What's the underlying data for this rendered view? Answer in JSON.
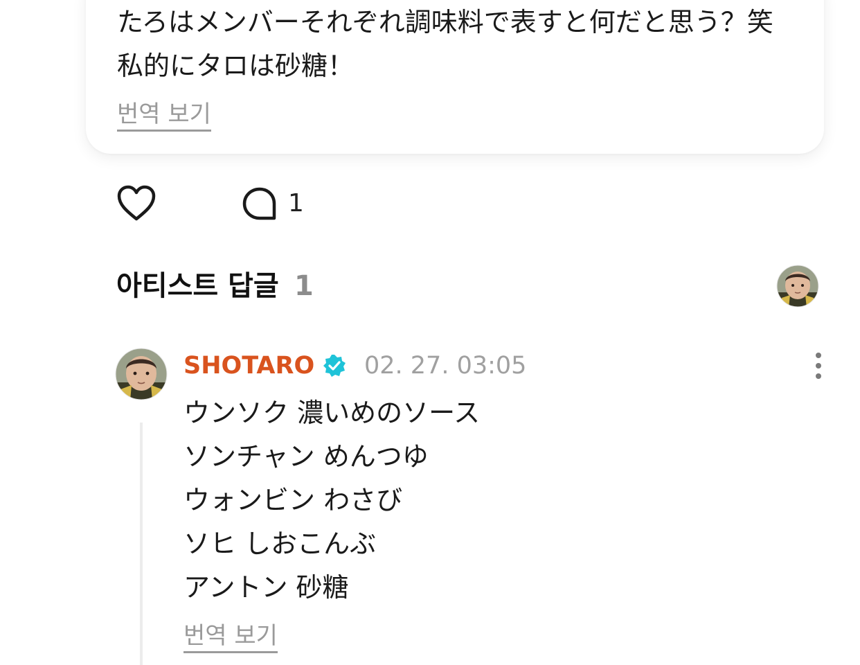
{
  "post": {
    "text_line1": "たろはメンバーそれぞれ調味料で表すと何だと思う？笑",
    "text_line2": "私的にタロは砂糖！",
    "translate_label": "번역 보기"
  },
  "actions": {
    "like_icon": "heart-icon",
    "comment_icon": "comment-bubble-icon",
    "comment_count": "1"
  },
  "artist_replies": {
    "title": "아티스트 답글",
    "count": "1"
  },
  "reply": {
    "author": "SHOTARO",
    "verified_icon": "verified-badge-icon",
    "timestamp": "02. 27. 03:05",
    "lines": [
      "ウンソク 濃いめのソース",
      "ソンチャン めんつゆ",
      "ウォンビン わさび",
      "ソヒ しおこんぶ",
      "アントン 砂糖"
    ],
    "translate_label": "번역 보기"
  },
  "colors": {
    "author_accent": "#d9531e",
    "verified_badge": "#1fc3d8",
    "muted_text": "#9a9a9a"
  }
}
